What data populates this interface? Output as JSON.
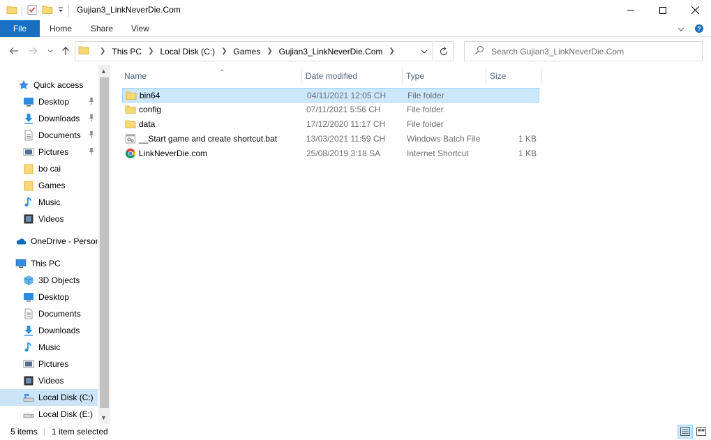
{
  "window": {
    "title": "Gujian3_LinkNeverDie.Com"
  },
  "ribbon": {
    "tabs": [
      "File",
      "Home",
      "Share",
      "View"
    ]
  },
  "address": {
    "crumbs": [
      "This PC",
      "Local Disk (C:)",
      "Games",
      "Gujian3_LinkNeverDie.Com"
    ]
  },
  "search": {
    "placeholder": "Search Gujian3_LinkNeverDie.Com"
  },
  "nav": {
    "quick_access": "Quick access",
    "quick_items": [
      "Desktop",
      "Downloads",
      "Documents",
      "Pictures",
      "bo cai",
      "Games",
      "Music",
      "Videos"
    ],
    "onedrive": "OneDrive - Personal",
    "this_pc": "This PC",
    "pc_items": [
      "3D Objects",
      "Desktop",
      "Documents",
      "Downloads",
      "Music",
      "Pictures",
      "Videos",
      "Local Disk (C:)",
      "Local Disk (E:)"
    ]
  },
  "columns": {
    "name": "Name",
    "date": "Date modified",
    "type": "Type",
    "size": "Size"
  },
  "files": [
    {
      "name": "bin64",
      "date": "04/11/2021 12:05 CH",
      "type": "File folder",
      "size": "",
      "icon": "folder-icon"
    },
    {
      "name": "config",
      "date": "07/11/2021 5:56 CH",
      "type": "File folder",
      "size": "",
      "icon": "folder-icon"
    },
    {
      "name": "data",
      "date": "17/12/2020 11:17 CH",
      "type": "File folder",
      "size": "",
      "icon": "folder-icon"
    },
    {
      "name": "__Start game and create shortcut.bat",
      "date": "13/03/2021 11:59 CH",
      "type": "Windows Batch File",
      "size": "1 KB",
      "icon": "batch-file-icon"
    },
    {
      "name": "LinkNeverDie.com",
      "date": "25/08/2019 3:18 SA",
      "type": "Internet Shortcut",
      "size": "1 KB",
      "icon": "chrome-shortcut-icon"
    }
  ],
  "status": {
    "count": "5 items",
    "selected": "1 item selected"
  },
  "colors": {
    "accent": "#1a6fc0",
    "selection": "#cce8ff",
    "folder": "#f8d775"
  }
}
